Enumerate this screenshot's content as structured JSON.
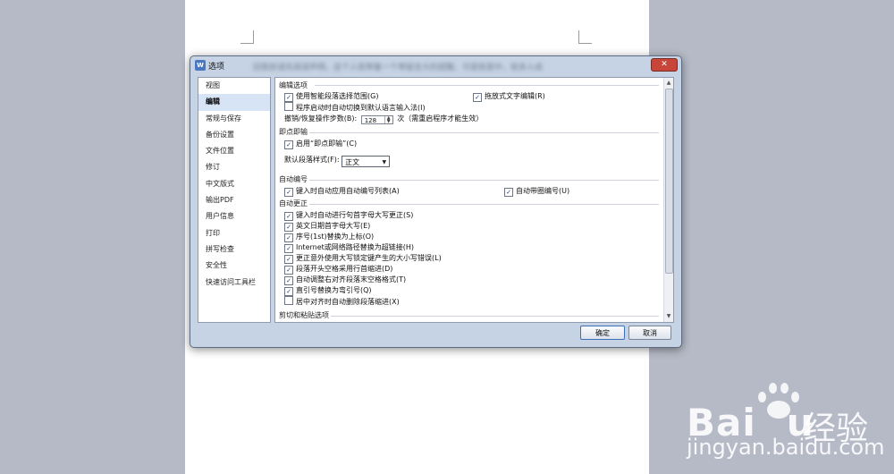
{
  "dialog": {
    "title": "选项",
    "app_icon": "W",
    "blurred_caption": "回答前请先阅读声明，这个人就带着一个带留言大的提醒，可是就是中，就多人成",
    "close_symbol": "✕"
  },
  "nav": {
    "items": [
      "视图",
      "编辑",
      "常规与保存",
      "备份设置",
      "文件位置",
      "修订",
      "中文版式",
      "输出PDF",
      "用户信息",
      "打印",
      "拼写检查",
      "安全性",
      "快速访问工具栏"
    ],
    "selected_index": 1
  },
  "sections": {
    "edit_options": {
      "title": "编辑选项",
      "smart_select": {
        "label": "使用智能段落选择范围",
        "key": "(G)",
        "checked": true
      },
      "drag_edit": {
        "label": "拖放式文字编辑",
        "key": "(R)",
        "checked": true
      },
      "auto_ime": {
        "label": "程序启动时自动切换到默认语言输入法",
        "key": "(I)",
        "checked": false
      },
      "undo_steps": {
        "label": "撤销/恢复操作步数",
        "key": "(B)",
        "value": "128",
        "suffix": "次（需重启程序才能生效）"
      }
    },
    "click_and_type": {
      "title": "即点即输",
      "enable": {
        "label": "启用“即点即输”",
        "key": "(C)",
        "checked": true
      },
      "default_style_label": "默认段落样式(F):",
      "default_style_value": "正文"
    },
    "auto_number": {
      "title": "自动编号",
      "auto_list": {
        "label": "键入时自动应用自动编号列表",
        "key": "(A)",
        "checked": true
      },
      "circle_number": {
        "label": "自动带圈编号",
        "key": "(U)",
        "checked": true
      }
    },
    "auto_correct": {
      "title": "自动更正",
      "items": [
        {
          "label": "键入时自动进行句首字母大写更正",
          "key": "(S)",
          "checked": true
        },
        {
          "label": "英文日期首字母大写",
          "key": "(E)",
          "checked": true
        },
        {
          "label": "序号(1st)替换为上标",
          "key": "(O)",
          "checked": true
        },
        {
          "label": "Internet或网络路径替换为超链接",
          "key": "(H)",
          "checked": true
        },
        {
          "label": "更正意外使用大写锁定键产生的大小写错误",
          "key": "(L)",
          "checked": true
        },
        {
          "label": "段落开头空格采用行首缩进",
          "key": "(D)",
          "checked": true
        },
        {
          "label": "自动调整右对齐段落末空格格式",
          "key": "(T)",
          "checked": true
        },
        {
          "label": "直引号替换为弯引号",
          "key": "(Q)",
          "checked": true
        },
        {
          "label": "居中对齐时自动删除段落缩进",
          "key": "(X)",
          "checked": false
        }
      ]
    },
    "cut_paste": {
      "title": "剪切和粘贴选项"
    }
  },
  "buttons": {
    "ok": "确定",
    "cancel": "取消"
  },
  "watermark": {
    "brand": "Bai",
    "brand_end": "u",
    "cn": "经验",
    "url": "jingyan.baidu.com"
  }
}
